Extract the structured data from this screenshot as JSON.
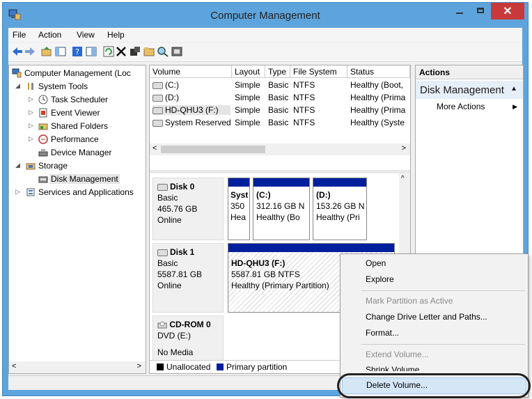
{
  "window": {
    "title": "Computer Management",
    "colors": {
      "frame": "#5ea4dc",
      "close": "#c7393a",
      "partition_bar": "#001f9c",
      "selection": "#d5e6f7"
    }
  },
  "menubar": [
    "File",
    "Action",
    "View",
    "Help"
  ],
  "toolbar_icons": [
    "back-arrow-icon",
    "forward-arrow-icon",
    "up-folder-icon",
    "show-hide-tree-icon",
    "help-icon",
    "properties-icon",
    "refresh-icon",
    "delete-icon",
    "settings-icon",
    "open-folder-icon",
    "search-icon",
    "disk-icon"
  ],
  "tree": [
    {
      "label": "Computer Management (Loc",
      "level": 0,
      "expander": "",
      "icon": "computer-icon"
    },
    {
      "label": "System Tools",
      "level": 1,
      "expander": "◢",
      "icon": "tools-icon"
    },
    {
      "label": "Task Scheduler",
      "level": 2,
      "expander": "▷",
      "icon": "clock-icon"
    },
    {
      "label": "Event Viewer",
      "level": 2,
      "expander": "▷",
      "icon": "event-viewer-icon"
    },
    {
      "label": "Shared Folders",
      "level": 2,
      "expander": "▷",
      "icon": "shared-folder-icon"
    },
    {
      "label": "Performance",
      "level": 2,
      "expander": "▷",
      "icon": "performance-icon"
    },
    {
      "label": "Device Manager",
      "level": 2,
      "expander": "",
      "icon": "device-manager-icon"
    },
    {
      "label": "Storage",
      "level": 1,
      "expander": "◢",
      "icon": "storage-icon"
    },
    {
      "label": "Disk Management",
      "level": 2,
      "expander": "",
      "icon": "disk-management-icon",
      "selected": true
    },
    {
      "label": "Services and Applications",
      "level": 1,
      "expander": "▷",
      "icon": "services-icon"
    }
  ],
  "volumes": {
    "columns": [
      "Volume",
      "Layout",
      "Type",
      "File System",
      "Status"
    ],
    "rows": [
      [
        "(C:)",
        "Simple",
        "Basic",
        "NTFS",
        "Healthy (Boot,"
      ],
      [
        "(D:)",
        "Simple",
        "Basic",
        "NTFS",
        "Healthy (Prima"
      ],
      [
        "HD-QHU3 (F:)",
        "Simple",
        "Basic",
        "NTFS",
        "Healthy (Prima"
      ],
      [
        "System Reserved",
        "Simple",
        "Basic",
        "NTFS",
        "Healthy (Syste"
      ]
    ]
  },
  "disks": [
    {
      "name": "Disk 0",
      "type": "Basic",
      "size": "465.76 GB",
      "state": "Online",
      "partitions": [
        {
          "l1": "Syst",
          "l2": "350",
          "l3": "Hea"
        },
        {
          "l1": "(C:)",
          "l2": "312.16 GB N",
          "l3": "Healthy (Bo"
        },
        {
          "l1": "(D:)",
          "l2": "153.26 GB N",
          "l3": "Healthy (Pri"
        }
      ]
    },
    {
      "name": "Disk 1",
      "type": "Basic",
      "size": "5587.81 GB",
      "state": "Online",
      "partitions": [
        {
          "l1": "HD-QHU3  (F:)",
          "l2": "5587.81 GB NTFS",
          "l3": "Healthy (Primary Partition)"
        }
      ]
    },
    {
      "name": "CD-ROM 0",
      "type": "DVD (E:)",
      "size": "",
      "state": "No Media"
    }
  ],
  "legend": {
    "unallocated": "Unallocated",
    "primary": "Primary partition"
  },
  "actions": {
    "header": "Actions",
    "section": "Disk Management",
    "more": "More Actions"
  },
  "context_menu": [
    {
      "label": "Open",
      "disabled": false
    },
    {
      "label": "Explore",
      "disabled": false
    },
    {
      "label": "Mark Partition as Active",
      "disabled": true
    },
    {
      "label": "Change Drive Letter and Paths...",
      "disabled": false
    },
    {
      "label": "Format...",
      "disabled": false
    },
    {
      "label": "Extend Volume...",
      "disabled": true
    },
    {
      "label": "Shrink Volume...",
      "disabled": false
    },
    {
      "label": "Delete Volume...",
      "disabled": false,
      "highlighted": true
    }
  ]
}
